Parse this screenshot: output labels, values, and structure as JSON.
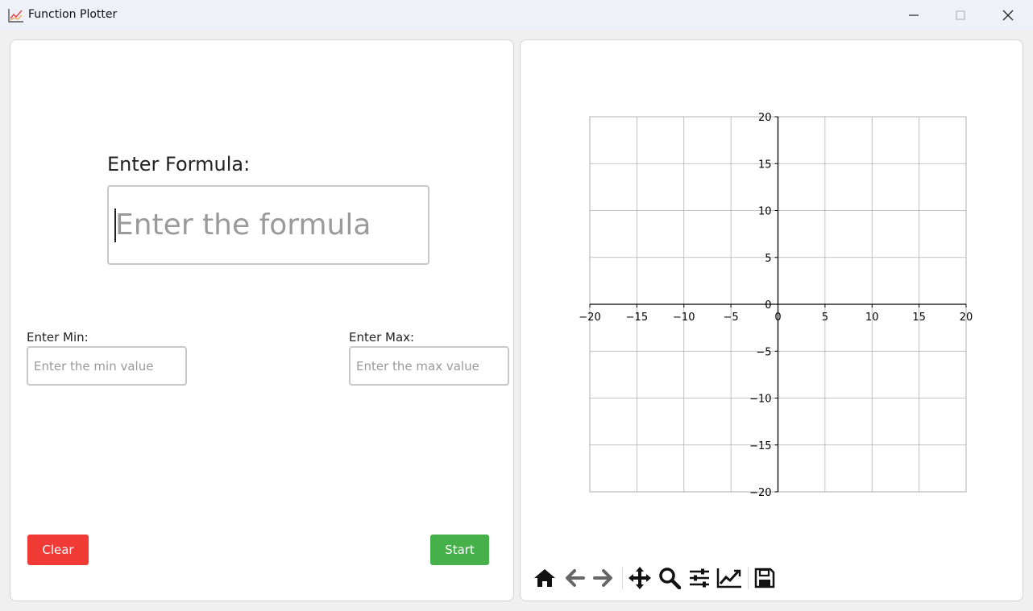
{
  "window": {
    "title": "Function Plotter",
    "icon": "line-chart-icon",
    "controls": [
      "minimize-icon",
      "maximize-icon",
      "close-icon"
    ]
  },
  "form": {
    "formula_label": "Enter Formula:",
    "formula_value": "",
    "formula_placeholder": "Enter the formula",
    "min_label": "Enter Min:",
    "min_value": "",
    "min_placeholder": "Enter the min value",
    "max_label": "Enter Max:",
    "max_value": "",
    "max_placeholder": "Enter the max value",
    "clear_label": "Clear",
    "start_label": "Start"
  },
  "colors": {
    "clear_button": "#f03a35",
    "start_button": "#46b04a"
  },
  "toolbar": {
    "tools": [
      "home-icon",
      "back-arrow-icon",
      "forward-arrow-icon",
      "pan-icon",
      "zoom-icon",
      "configure-subplots-icon",
      "edit-axis-icon",
      "save-icon"
    ]
  },
  "chart_data": {
    "type": "line",
    "series": [],
    "xlim": [
      -20,
      20
    ],
    "ylim": [
      -20,
      20
    ],
    "xticks": [
      "−20",
      "−15",
      "−10",
      "−5",
      "0",
      "5",
      "10",
      "15",
      "20"
    ],
    "yticks": [
      "20",
      "15",
      "10",
      "5",
      "0",
      "−5",
      "−10",
      "−15",
      "−20"
    ],
    "grid": true,
    "axes_through_origin": true
  }
}
